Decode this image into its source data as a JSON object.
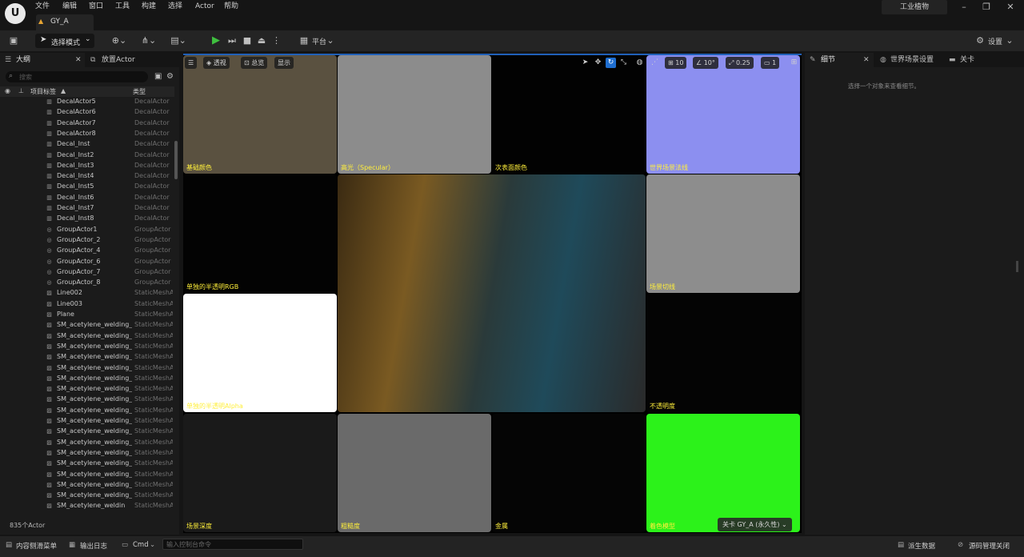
{
  "menu": [
    "文件",
    "编辑",
    "窗口",
    "工具",
    "构建",
    "选择",
    "Actor",
    "帮助"
  ],
  "project_name": "工业植物",
  "document_tab": "GY_A",
  "toolbar": {
    "mode_label": "选择模式",
    "platform_label": "平台",
    "settings_label": "设置"
  },
  "outliner": {
    "tabs": [
      "大纲",
      "放置Actor"
    ],
    "search_placeholder": "搜索",
    "column_label": "项目标签",
    "column_type": "类型",
    "rows": [
      {
        "name": "DecalActor5",
        "type": "DecalActor",
        "icon": "decal-icon"
      },
      {
        "name": "DecalActor6",
        "type": "DecalActor",
        "icon": "decal-icon"
      },
      {
        "name": "DecalActor7",
        "type": "DecalActor",
        "icon": "decal-icon"
      },
      {
        "name": "DecalActor8",
        "type": "DecalActor",
        "icon": "decal-icon"
      },
      {
        "name": "Decal_Inst",
        "type": "DecalActor",
        "icon": "decal-icon"
      },
      {
        "name": "Decal_Inst2",
        "type": "DecalActor",
        "icon": "decal-icon"
      },
      {
        "name": "Decal_Inst3",
        "type": "DecalActor",
        "icon": "decal-icon"
      },
      {
        "name": "Decal_Inst4",
        "type": "DecalActor",
        "icon": "decal-icon"
      },
      {
        "name": "Decal_Inst5",
        "type": "DecalActor",
        "icon": "decal-icon"
      },
      {
        "name": "Decal_Inst6",
        "type": "DecalActor",
        "icon": "decal-icon"
      },
      {
        "name": "Decal_Inst7",
        "type": "DecalActor",
        "icon": "decal-icon"
      },
      {
        "name": "Decal_Inst8",
        "type": "DecalActor",
        "icon": "decal-icon"
      },
      {
        "name": "GroupActor1",
        "type": "GroupActor",
        "icon": "group-icon"
      },
      {
        "name": "GroupActor_2",
        "type": "GroupActor",
        "icon": "group-icon"
      },
      {
        "name": "GroupActor_4",
        "type": "GroupActor",
        "icon": "group-icon"
      },
      {
        "name": "GroupActor_6",
        "type": "GroupActor",
        "icon": "group-icon"
      },
      {
        "name": "GroupActor_7",
        "type": "GroupActor",
        "icon": "group-icon"
      },
      {
        "name": "GroupActor_8",
        "type": "GroupActor",
        "icon": "group-icon"
      },
      {
        "name": "Line002",
        "type": "StaticMeshA",
        "icon": "mesh-icon"
      },
      {
        "name": "Line003",
        "type": "StaticMeshA",
        "icon": "mesh-icon"
      },
      {
        "name": "Plane",
        "type": "StaticMeshA",
        "icon": "mesh-icon"
      },
      {
        "name": "SM_acetylene_welding_",
        "type": "StaticMeshA",
        "icon": "mesh-icon"
      },
      {
        "name": "SM_acetylene_welding_",
        "type": "StaticMeshA",
        "icon": "mesh-icon"
      },
      {
        "name": "SM_acetylene_welding_",
        "type": "StaticMeshA",
        "icon": "mesh-icon"
      },
      {
        "name": "SM_acetylene_welding_",
        "type": "StaticMeshA",
        "icon": "mesh-icon"
      },
      {
        "name": "SM_acetylene_welding_",
        "type": "StaticMeshA",
        "icon": "mesh-icon"
      },
      {
        "name": "SM_acetylene_welding_",
        "type": "StaticMeshA",
        "icon": "mesh-icon"
      },
      {
        "name": "SM_acetylene_welding_",
        "type": "StaticMeshA",
        "icon": "mesh-icon"
      },
      {
        "name": "SM_acetylene_welding_",
        "type": "StaticMeshA",
        "icon": "mesh-icon"
      },
      {
        "name": "SM_acetylene_welding_",
        "type": "StaticMeshA",
        "icon": "mesh-icon"
      },
      {
        "name": "SM_acetylene_welding_",
        "type": "StaticMeshA",
        "icon": "mesh-icon"
      },
      {
        "name": "SM_acetylene_welding_",
        "type": "StaticMeshA",
        "icon": "mesh-icon"
      },
      {
        "name": "SM_acetylene_welding_",
        "type": "StaticMeshA",
        "icon": "mesh-icon"
      },
      {
        "name": "SM_acetylene_welding_",
        "type": "StaticMeshA",
        "icon": "mesh-icon"
      },
      {
        "name": "SM_acetylene_welding_",
        "type": "StaticMeshA",
        "icon": "mesh-icon"
      },
      {
        "name": "SM_acetylene_welding_",
        "type": "StaticMeshA",
        "icon": "mesh-icon"
      },
      {
        "name": "SM_acetylene_welding_",
        "type": "StaticMeshA",
        "icon": "mesh-icon"
      },
      {
        "name": "SM_acetylene_welding_",
        "type": "StaticMeshA",
        "icon": "mesh-icon"
      },
      {
        "name": "SM_acetylene_weldin",
        "type": "StaticMeshA",
        "icon": "mesh-icon"
      }
    ],
    "actor_count": "835个Actor"
  },
  "viewport": {
    "overlay": {
      "perspective": "透视",
      "view_mode": "总览",
      "show": "显示",
      "grid_snap": "10",
      "rotate_snap": "10°",
      "scale_snap": "0.25",
      "camera_speed": "1"
    },
    "tiles": [
      {
        "label": "基础颜色",
        "bg": "#5a5140"
      },
      {
        "label": "高光（Specular）",
        "bg": "#8c8c8c"
      },
      {
        "label": "次表面颜色",
        "bg": "#020202"
      },
      {
        "label": "世界场景法线",
        "bg": "#8c8ff0"
      },
      {
        "label": "单独的半透明RGB",
        "bg": "#030303"
      },
      {
        "label": "场景切线",
        "bg": "#8d8d8d"
      },
      {
        "label": "单独的半透明Alpha",
        "bg": "#ffffff"
      },
      {
        "label": "不透明度",
        "bg": "#040404"
      },
      {
        "label": "场景深度",
        "bg": "#1a1a1a"
      },
      {
        "label": "粗糙度",
        "bg": "#6a6a6a"
      },
      {
        "label": "金属",
        "bg": "#050505"
      },
      {
        "label": "着色模型",
        "bg": "#2cf21a"
      }
    ],
    "level_badge": "关卡  GY_A (永久性)"
  },
  "details": {
    "tabs": [
      "细节",
      "世界场景设置",
      "关卡"
    ],
    "hint": "选择一个对象来查看细节。"
  },
  "statusbar": {
    "content_drawer": "内容侧滑菜单",
    "output_log": "输出日志",
    "cmd": "Cmd",
    "cmd_placeholder": "输入控制台命令",
    "derived_data": "派生数据",
    "source_control": "源码管理关闭"
  },
  "colors": {
    "accent": "#2060b8",
    "tile_label": "#ffef3b",
    "play": "#3fbf3f"
  }
}
